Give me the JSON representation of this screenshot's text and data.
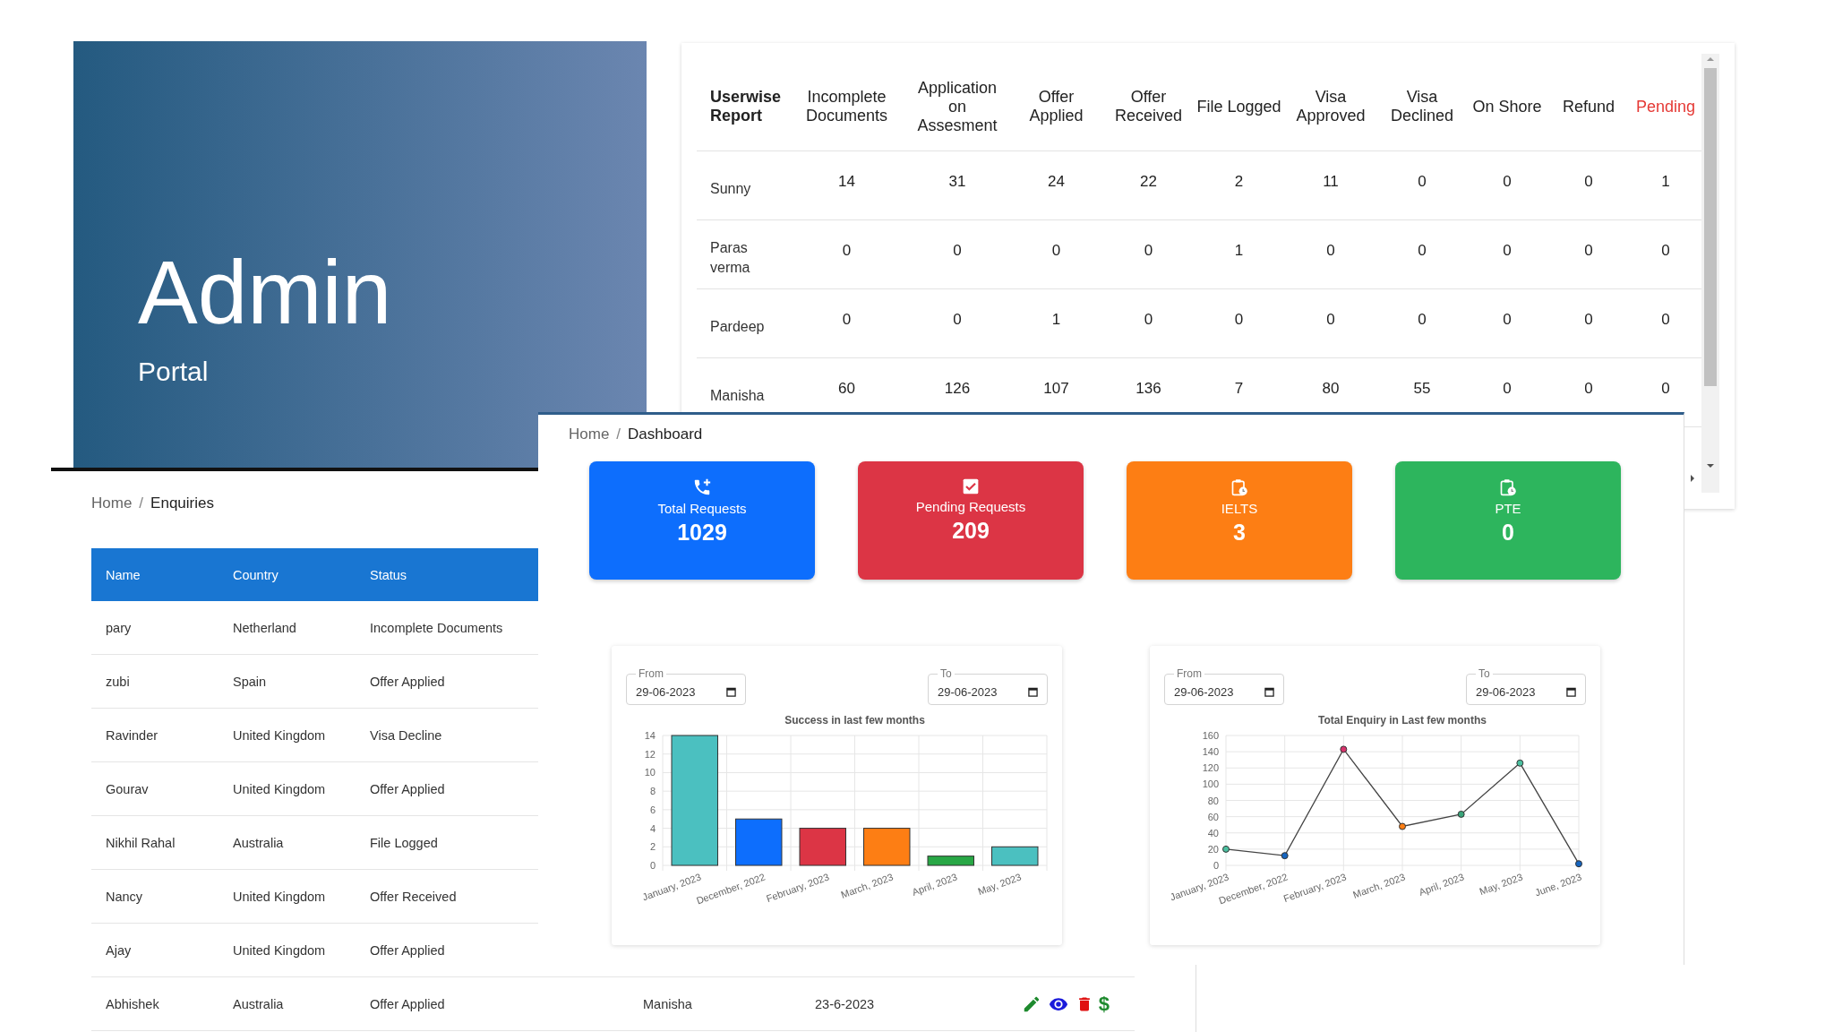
{
  "banner": {
    "title": "Admin",
    "subtitle": "Portal"
  },
  "report": {
    "columns": [
      {
        "label": "Userwise Report",
        "highlighted": false
      },
      {
        "label": "Incomplete Documents",
        "highlighted": false
      },
      {
        "label": "Application on Assesment",
        "highlighted": false
      },
      {
        "label": "Offer Applied",
        "highlighted": false
      },
      {
        "label": "Offer Received",
        "highlighted": false
      },
      {
        "label": "File Logged",
        "highlighted": false
      },
      {
        "label": "Visa Approved",
        "highlighted": false
      },
      {
        "label": "Visa Declined",
        "highlighted": false
      },
      {
        "label": "On Shore",
        "highlighted": false
      },
      {
        "label": "Refund",
        "highlighted": false
      },
      {
        "label": "Pending",
        "highlighted": true
      }
    ],
    "rows": [
      {
        "name": "Sunny",
        "values": [
          "14",
          "31",
          "24",
          "22",
          "2",
          "11",
          "0",
          "0",
          "0",
          "1"
        ]
      },
      {
        "name": "Paras verma",
        "values": [
          "0",
          "0",
          "0",
          "0",
          "1",
          "0",
          "0",
          "0",
          "0",
          "0"
        ]
      },
      {
        "name": "Pardeep",
        "values": [
          "0",
          "0",
          "1",
          "0",
          "0",
          "0",
          "0",
          "0",
          "0",
          "0"
        ]
      },
      {
        "name": "Manisha",
        "values": [
          "60",
          "126",
          "107",
          "136",
          "7",
          "80",
          "55",
          "0",
          "0",
          "0"
        ]
      }
    ]
  },
  "dashboard": {
    "breadcrumb": {
      "separator": "/",
      "items": [
        {
          "label": "Home",
          "current": false
        },
        {
          "label": "Dashboard",
          "current": true
        }
      ]
    },
    "cards": [
      {
        "kind": "phone",
        "label": "Total Requests",
        "value": "1029",
        "color": "#0d6efd"
      },
      {
        "kind": "check",
        "label": "Pending Requests",
        "value": "209",
        "color": "#dc3545"
      },
      {
        "kind": "clipboard",
        "label": "IELTS",
        "value": "3",
        "color": "#fd7e14"
      },
      {
        "kind": "clipboard",
        "label": "PTE",
        "value": "0",
        "color": "#2db55d"
      }
    ],
    "charts": [
      {
        "from": {
          "label": "From",
          "value": "29-06-2023"
        },
        "to": {
          "label": "To",
          "value": "29-06-2023"
        },
        "bars": [
          {
            "color": "#4bc0c0"
          },
          {
            "color": "#0d6efd"
          },
          {
            "color": "#dc3545"
          },
          {
            "color": "#fd7e14"
          },
          {
            "color": "#28a745"
          },
          {
            "color": "#4bc0c0"
          }
        ],
        "chart_data": {
          "type": "bar",
          "grid": true,
          "title": "Success in last few months",
          "categories": [
            "January, 2023",
            "December, 2022",
            "February, 2023",
            "March, 2023",
            "April, 2023",
            "May, 2023"
          ],
          "values": [
            14,
            5,
            4,
            4,
            1,
            2
          ],
          "ylim": [
            0,
            14
          ],
          "yticks": [
            0,
            2,
            4,
            6,
            8,
            10,
            12,
            14
          ]
        }
      },
      {
        "from": {
          "label": "From",
          "value": "29-06-2023"
        },
        "to": {
          "label": "To",
          "value": "29-06-2023"
        },
        "points": [
          {
            "color": "#4bc0a0"
          },
          {
            "color": "#1565c0"
          },
          {
            "color": "#d6336c"
          },
          {
            "color": "#fd7e14"
          },
          {
            "color": "#3aa57a"
          },
          {
            "color": "#4bc0a0"
          },
          {
            "color": "#1565c0"
          }
        ],
        "chart_data": {
          "type": "line",
          "grid": true,
          "marker": true,
          "title": "Total Enquiry in Last few months",
          "categories": [
            "January, 2023",
            "December, 2022",
            "February, 2023",
            "March, 2023",
            "April, 2023",
            "May, 2023",
            "June, 2023"
          ],
          "values": [
            20,
            12,
            143,
            48,
            63,
            126,
            2
          ],
          "ylim": [
            0,
            160
          ],
          "yticks": [
            0,
            20,
            40,
            60,
            80,
            100,
            120,
            140,
            160
          ]
        }
      }
    ]
  },
  "enquiries": {
    "breadcrumb": {
      "separator": "/",
      "items": [
        {
          "label": "Home",
          "current": false
        },
        {
          "label": "Enquiries",
          "current": true
        }
      ]
    },
    "columns": [
      "Name",
      "Country",
      "Status"
    ],
    "rows": [
      {
        "cells": [
          "pary",
          "Netherland",
          "Incomplete Documents"
        ]
      },
      {
        "cells": [
          "zubi",
          "Spain",
          "Offer Applied"
        ]
      },
      {
        "cells": [
          "Ravinder",
          "United Kingdom",
          "Visa Decline"
        ]
      },
      {
        "cells": [
          "Gourav",
          "United Kingdom",
          "Offer Applied"
        ]
      },
      {
        "cells": [
          "Nikhil Rahal",
          "Australia",
          "File Logged"
        ]
      },
      {
        "cells": [
          "Nancy",
          "United Kingdom",
          "Offer Received"
        ]
      },
      {
        "cells": [
          "Ajay",
          "United Kingdom",
          "Offer Applied"
        ]
      },
      {
        "cells": [
          "Abhishek",
          "Australia",
          "Offer Applied",
          "Manisha",
          "23-6-2023"
        ],
        "actions": [
          {
            "kind": "edit"
          },
          {
            "kind": "view"
          },
          {
            "kind": "delete"
          },
          {
            "kind": "payment",
            "symbol": "$"
          }
        ]
      }
    ]
  }
}
